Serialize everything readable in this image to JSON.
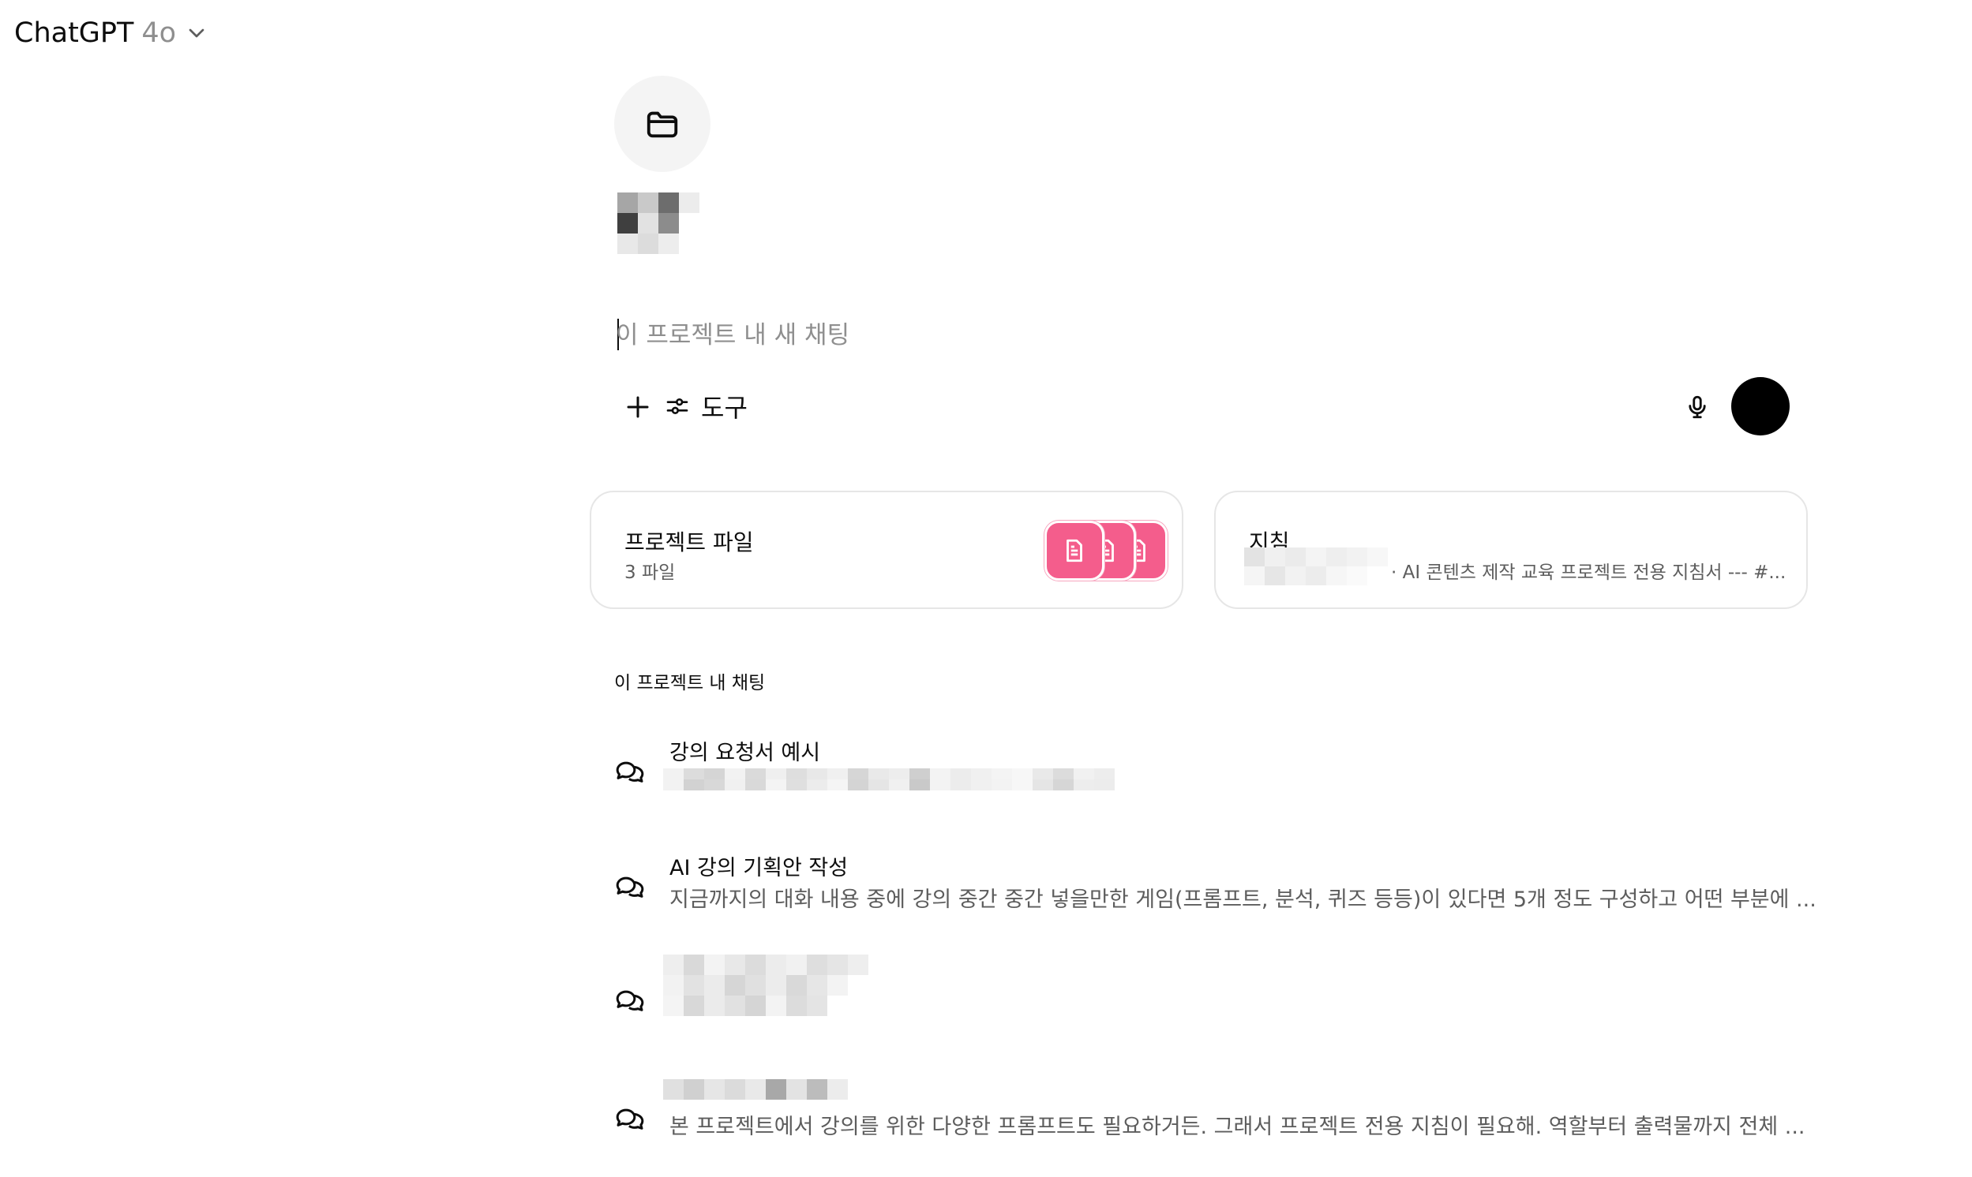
{
  "header": {
    "app_name": "ChatGPT",
    "model_version": "4o",
    "chevron_icon": "chevron-down-icon"
  },
  "project": {
    "icon": "folder-icon"
  },
  "composer": {
    "placeholder": "이 프로젝트 내 새 채팅",
    "plus_icon": "plus-icon",
    "tools_icon": "sliders-icon",
    "tools_label": "도구",
    "mic_icon": "microphone-icon"
  },
  "cards": {
    "files": {
      "title": "프로젝트 파일",
      "subtitle": "3 파일",
      "file_icon": "document-icon",
      "file_color": "#f45d8c"
    },
    "instructions": {
      "title": "지침",
      "text": "· AI 콘텐츠 제작 교육 프로젝트 전용 지침서 --- #..."
    }
  },
  "chats": {
    "section_label": "이 프로젝트 내 채팅",
    "items": [
      {
        "title": "강의 요청서 예시",
        "preview": ""
      },
      {
        "title": "AI 강의 기획안 작성",
        "preview": "지금까지의 대화 내용 중에 강의 중간 중간 넣을만한 게임(프롬프트, 분석, 퀴즈 등등)이 있다면 5개 정도 구성하고 어떤 부분에 ..."
      },
      {
        "title": "",
        "preview": ""
      },
      {
        "title": "",
        "preview": "본 프로젝트에서 강의를 위한 다양한 프롬프트도 필요하거든. 그래서 프로젝트 전용 지침이 필요해. 역할부터 출력물까지 전체 ..."
      }
    ]
  }
}
